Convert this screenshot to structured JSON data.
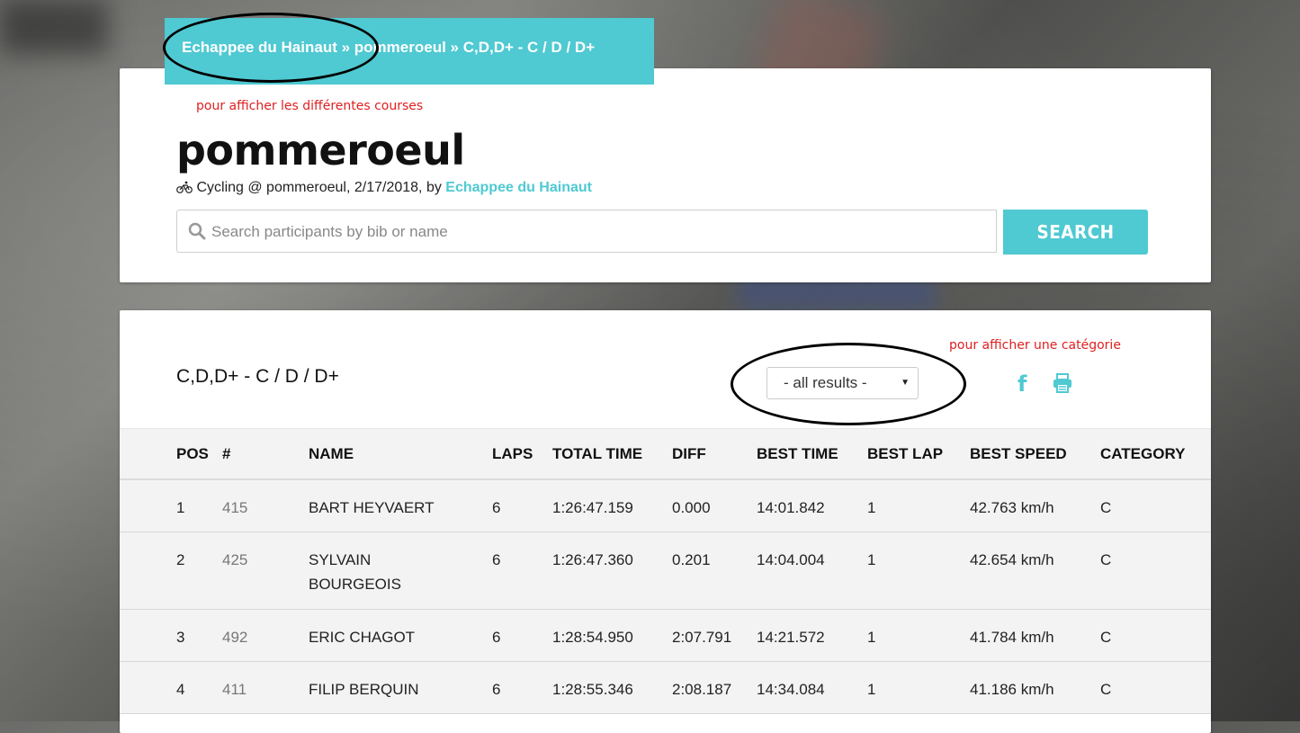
{
  "breadcrumb": {
    "organizer": "Echappee du Hainaut",
    "sep1": " » ",
    "event": "pommeroeul",
    "sep2": " » ",
    "race": "C,D,D+ - C / D / D+"
  },
  "annotations": {
    "courses_note": "pour afficher les différentes courses",
    "category_note": "pour afficher une catégorie"
  },
  "event": {
    "title": "pommeroeul",
    "meta_prefix": "Cycling @ pommeroeul, 2/17/2018, by ",
    "organizer_link": "Echappee du Hainaut"
  },
  "search": {
    "placeholder": "Search participants by bib or name",
    "button_label": "SEARCH"
  },
  "results": {
    "race_title": "C,D,D+ - C / D / D+",
    "filter_selected": "- all results -",
    "columns": [
      "POS",
      "#",
      "NAME",
      "LAPS",
      "TOTAL TIME",
      "DIFF",
      "BEST TIME",
      "BEST LAP",
      "BEST SPEED",
      "CATEGORY"
    ],
    "rows": [
      {
        "pos": "1",
        "bib": "415",
        "name": "BART HEYVAERT",
        "laps": "6",
        "total_time": "1:26:47.159",
        "diff": "0.000",
        "best_time": "14:01.842",
        "best_lap": "1",
        "best_speed": "42.763 km/h",
        "category": "C"
      },
      {
        "pos": "2",
        "bib": "425",
        "name": "SYLVAIN BOURGEOIS",
        "laps": "6",
        "total_time": "1:26:47.360",
        "diff": "0.201",
        "best_time": "14:04.004",
        "best_lap": "1",
        "best_speed": "42.654 km/h",
        "category": "C"
      },
      {
        "pos": "3",
        "bib": "492",
        "name": "ERIC CHAGOT",
        "laps": "6",
        "total_time": "1:28:54.950",
        "diff": "2:07.791",
        "best_time": "14:21.572",
        "best_lap": "1",
        "best_speed": "41.784 km/h",
        "category": "C"
      },
      {
        "pos": "4",
        "bib": "411",
        "name": "FILIP BERQUIN",
        "laps": "6",
        "total_time": "1:28:55.346",
        "diff": "2:08.187",
        "best_time": "14:34.084",
        "best_lap": "1",
        "best_speed": "41.186 km/h",
        "category": "C"
      }
    ]
  },
  "icons": {
    "sport": "cyclist-icon",
    "search": "search-icon",
    "share": "facebook-icon",
    "print": "print-icon"
  },
  "colors": {
    "accent": "#4fc9d2",
    "annotation": "#e02020"
  }
}
